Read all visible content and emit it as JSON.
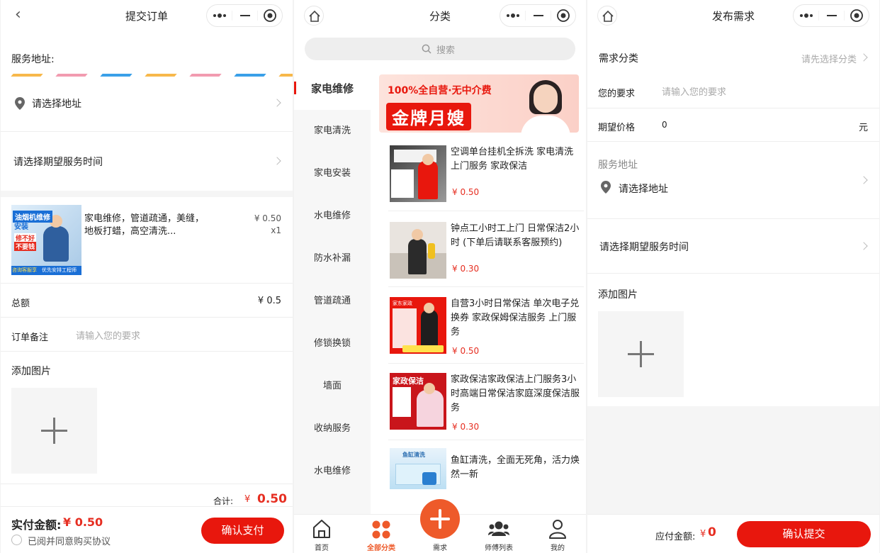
{
  "order": {
    "title": "提交订单",
    "address_heading": "服务地址:",
    "address_placeholder": "请选择地址",
    "time_placeholder": "请选择期望服务时间",
    "thumb_tag1": "油烟机维修",
    "thumb_tag2": "安装",
    "thumb_tag3": "修不好",
    "thumb_tag4": "不要钱",
    "thumb_tag5": "咨询客服享",
    "thumb_tag6": "优先安排工程师",
    "product_name": "家电维修，管道疏通，美缝，地板打蜡，高空清洗...",
    "product_price": "¥ 0.50",
    "product_qty": "x1",
    "total_label": "总额",
    "total_value": "¥ 0.5",
    "note_label": "订单备注",
    "note_placeholder": "请输入您的要求",
    "image_label": "添加图片",
    "subtotal_label": "合计:",
    "subtotal_currency": "¥",
    "subtotal_value": "0.50",
    "paid_label": "实付金额:",
    "paid_value": "¥ 0.50",
    "agree_text": "已阅并同意购买协议",
    "pay_button": "确认支付"
  },
  "category": {
    "title": "分类",
    "search_placeholder": "搜索",
    "items": [
      "家电维修",
      "家电清洗",
      "家电安装",
      "水电维修",
      "防水补漏",
      "管道疏通",
      "修锁换锁",
      "墙面",
      "收纳服务",
      "水电维修"
    ],
    "banner_line1": "100%全自营·无中介费",
    "banner_line2": "金牌月嫂",
    "products": [
      {
        "title": "空调单台挂机全拆洗 家电清洗上门服务 家政保洁",
        "price": "¥ 0.50"
      },
      {
        "title": "钟点工小时工上门 日常保洁2小时 (下单后请联系客服预约)",
        "price": "¥ 0.30"
      },
      {
        "title": "自营3小时日常保洁 单次电子兑换券 家政保姆保洁服务 上门服务",
        "price": "¥ 0.50"
      },
      {
        "title": "家政保洁家政保洁上门服务3小时高端日常保洁家庭深度保洁服务",
        "price": "¥ 0.30"
      },
      {
        "title": "鱼缸清洗，全面无死角，活力焕然一新",
        "price": ""
      }
    ],
    "thumb_labels": [
      "家东家政",
      "家政保洁",
      "鱼缸清洗"
    ],
    "tabs": [
      "首页",
      "全部分类",
      "需求",
      "师傅列表",
      "我的"
    ]
  },
  "demand": {
    "title": "发布需求",
    "category_label": "需求分类",
    "category_placeholder": "请先选择分类",
    "requirement_label": "您的要求",
    "requirement_placeholder": "请输入您的要求",
    "price_label": "期望价格",
    "price_value": "0",
    "price_unit": "元",
    "address_heading": "服务地址",
    "address_placeholder": "请选择地址",
    "time_placeholder": "请选择期望服务时间",
    "image_label": "添加图片",
    "due_label": "应付金额:",
    "due_currency": "¥",
    "due_value": "0",
    "submit_button": "确认提交"
  },
  "colors": {
    "accent": "#e8170d",
    "accent_orange": "#ee5a2a",
    "stripe_colors": [
      "#f7b84b",
      "#f29bb0",
      "#3aa0e8"
    ]
  }
}
